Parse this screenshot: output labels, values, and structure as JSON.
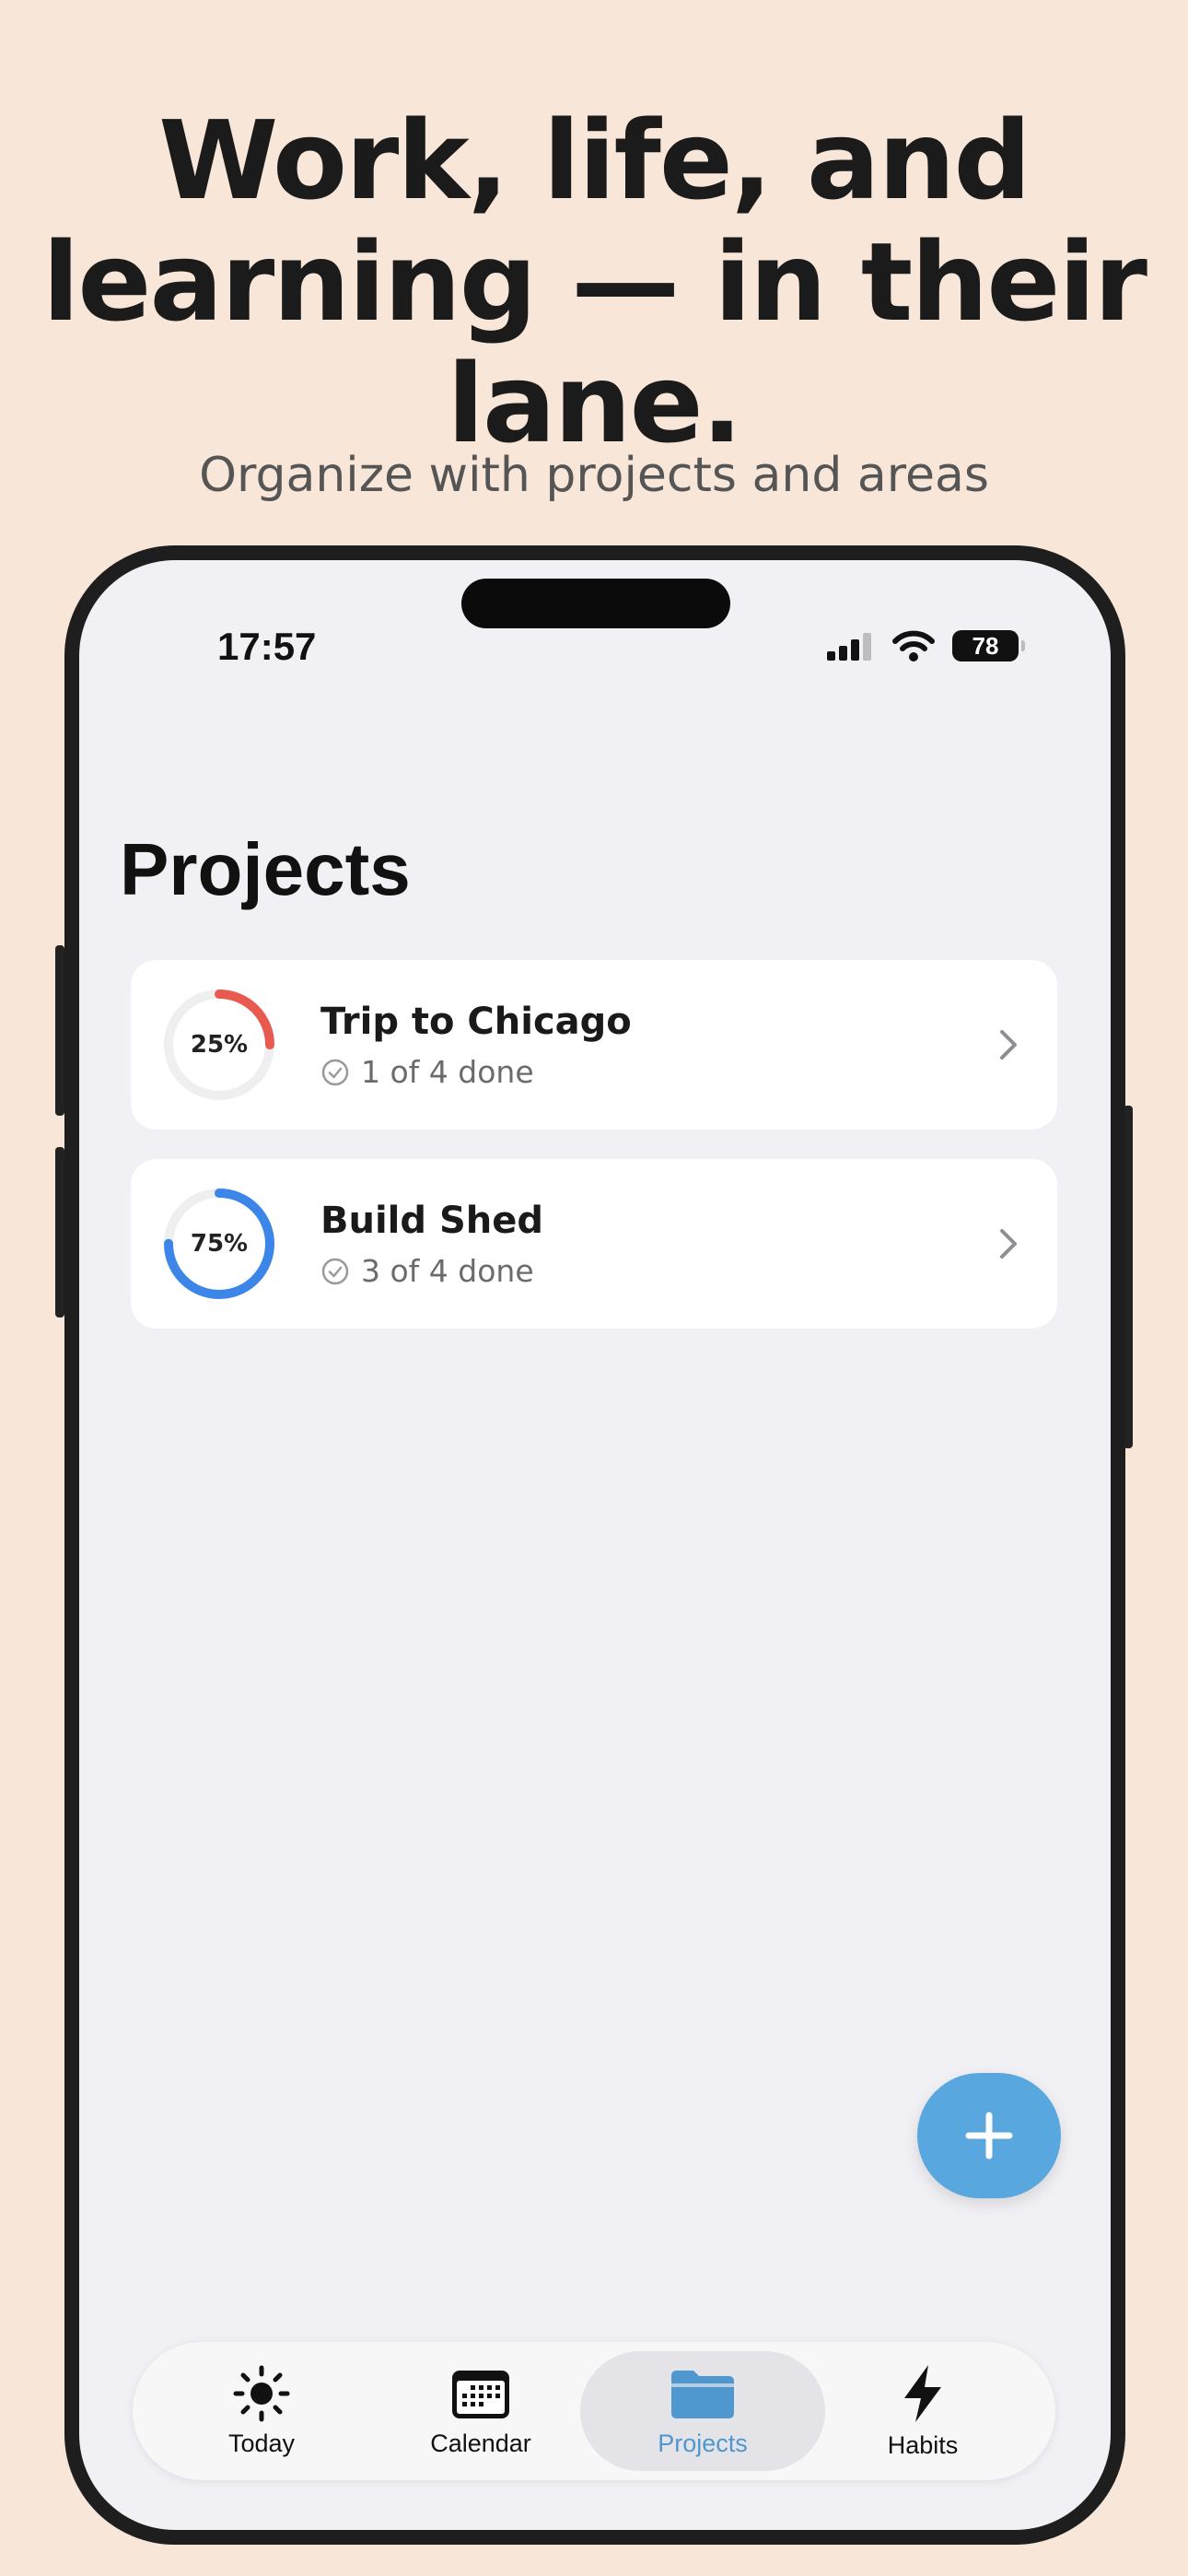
{
  "promo": {
    "headline": "Work, life, and learning — in their lane.",
    "subheadline": "Organize with projects and areas"
  },
  "status_bar": {
    "time": "17:57",
    "battery": "78",
    "icons": [
      "signal-icon",
      "wifi-icon",
      "battery-icon"
    ]
  },
  "page": {
    "title": "Projects"
  },
  "projects": [
    {
      "name": "Trip to Chicago",
      "progress_label": "25%",
      "progress": 0.25,
      "status": "1 of 4 done",
      "ring_color": "#e85a4f"
    },
    {
      "name": "Build Shed",
      "progress_label": "75%",
      "progress": 0.75,
      "status": "3 of 4 done",
      "ring_color": "#3b86e8"
    }
  ],
  "fab": {
    "icon": "plus-icon",
    "color": "#58a7de"
  },
  "tabs": [
    {
      "label": "Today",
      "icon": "sun-icon",
      "active": false
    },
    {
      "label": "Calendar",
      "icon": "calendar-icon",
      "active": false
    },
    {
      "label": "Projects",
      "icon": "folder-icon",
      "active": true
    },
    {
      "label": "Habits",
      "icon": "bolt-icon",
      "active": false
    }
  ],
  "colors": {
    "background": "#f8e7d9",
    "accent": "#58a7de",
    "screen": "#f1f1f5"
  }
}
